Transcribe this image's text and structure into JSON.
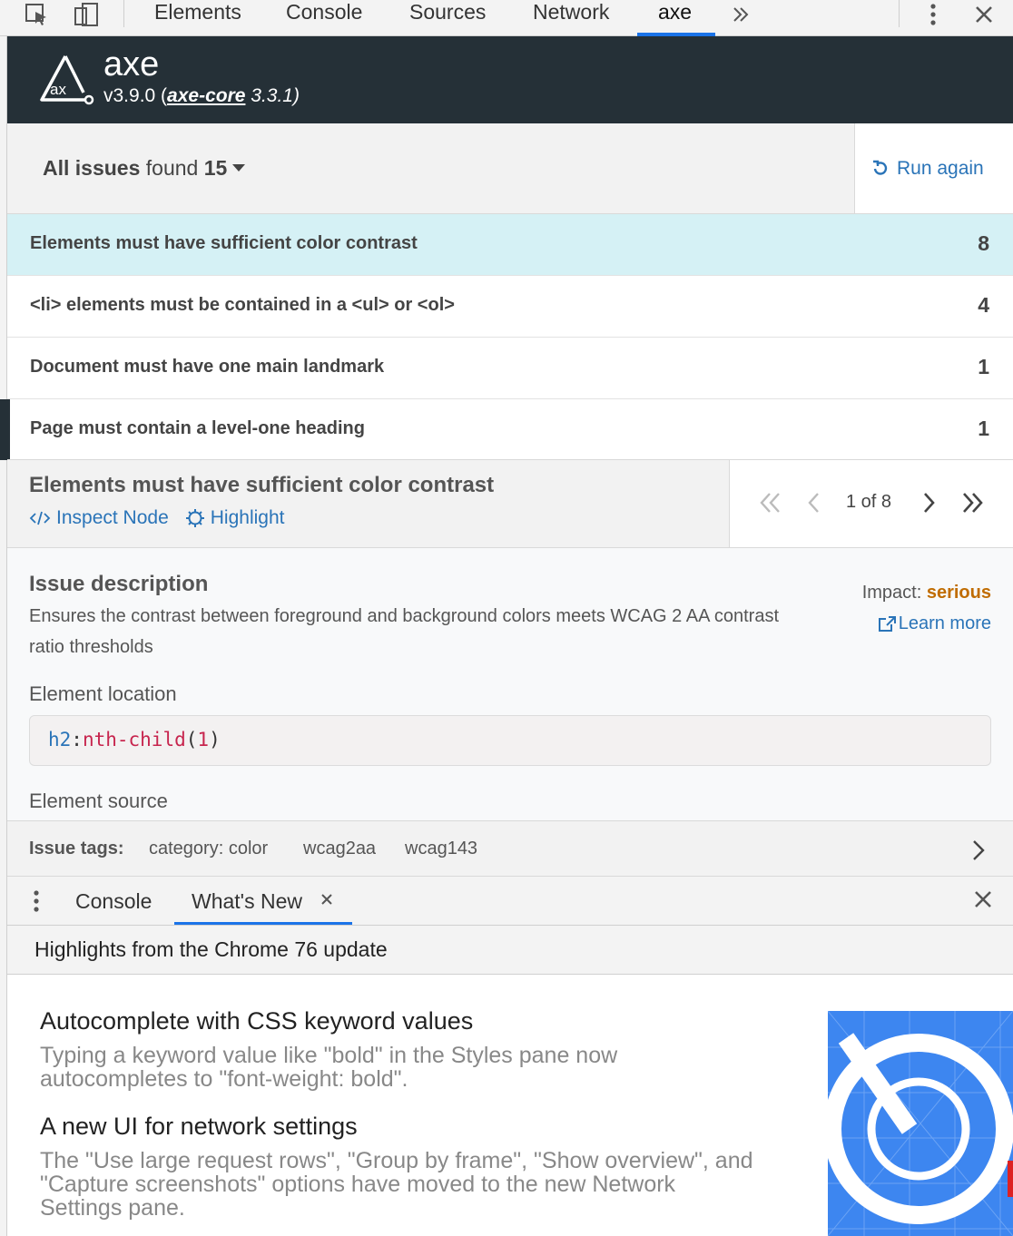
{
  "devtools": {
    "tabs": [
      "Elements",
      "Console",
      "Sources",
      "Network",
      "axe"
    ],
    "active_tab": "axe",
    "more_icon": "double-chevron-right-icon",
    "menu_icon": "vertical-dots-icon",
    "close_icon": "close-icon"
  },
  "axe": {
    "name": "axe",
    "version_prefix": "v3.9.0 (",
    "core_link": "axe-core",
    "core_version": " 3.3.1)",
    "logo_text": "ax"
  },
  "summary": {
    "label_bold": "All issues",
    "label_mid": " found ",
    "count": "15",
    "run_again": "Run again"
  },
  "issues": [
    {
      "label": "Elements must have sufficient color contrast",
      "count": "8"
    },
    {
      "label": "<li> elements must be contained in a <ul> or <ol>",
      "count": "4"
    },
    {
      "label": "Document must have one main landmark",
      "count": "1"
    },
    {
      "label": "Page must contain a level-one heading",
      "count": "1"
    }
  ],
  "detail": {
    "title": "Elements must have sufficient color contrast",
    "inspect_node": "Inspect Node",
    "highlight": "Highlight",
    "pager_text": "1 of 8"
  },
  "description": {
    "heading": "Issue description",
    "text": "Ensures the contrast between foreground and background colors meets WCAG 2 AA contrast ratio thresholds",
    "impact_label": "Impact: ",
    "impact_value": "serious",
    "learn_more": "Learn more",
    "element_location_label": "Element location",
    "selector_tag": "h2",
    "selector_colon": ":",
    "selector_pseudo": "nth-child",
    "selector_open": "(",
    "selector_arg": "1",
    "selector_close": ")",
    "element_source_label": "Element source"
  },
  "tags": {
    "label": "Issue tags:",
    "items": [
      "category: color",
      "wcag2aa",
      "wcag143"
    ]
  },
  "drawer": {
    "tabs": [
      "Console",
      "What's New"
    ],
    "active_tab": "What's New",
    "highlights": "Highlights from the Chrome 76 update"
  },
  "whats_new": [
    {
      "title": "Autocomplete with CSS keyword values",
      "text": "Typing a keyword value like \"bold\" in the Styles pane now autocompletes to \"font-weight: bold\"."
    },
    {
      "title": "A new UI for network settings",
      "text": "The \"Use large request rows\", \"Group by frame\", \"Show overview\", and \"Capture screenshots\" options have moved to the new Network Settings pane."
    }
  ],
  "colors": {
    "axe_header_bg": "#253037",
    "link_blue": "#2a74b8",
    "selected_row_bg": "#d5f1f5",
    "impact_serious": "#c06c00",
    "tab_underline": "#1a73e8"
  }
}
